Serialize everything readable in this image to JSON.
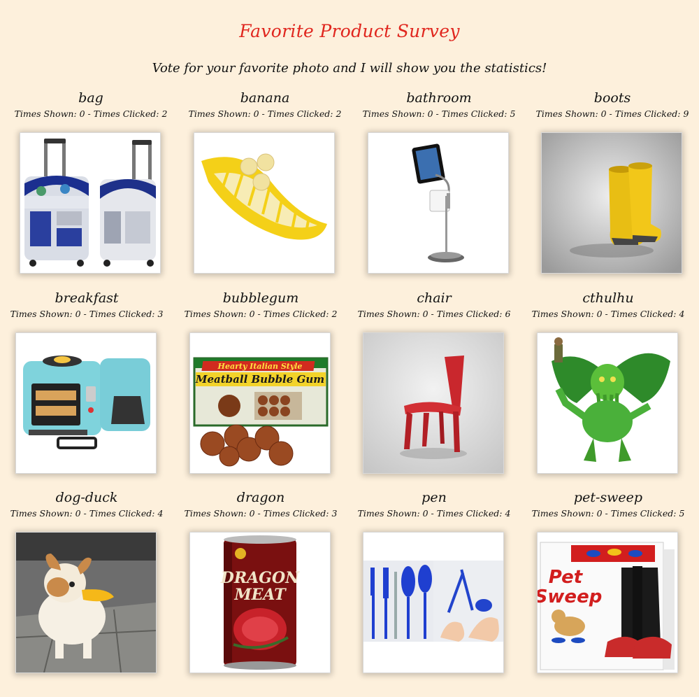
{
  "page": {
    "title": "Favorite Product Survey",
    "subtitle": "Vote for your favorite photo and I will show you the statistics!"
  },
  "colors": {
    "title": "#e0261e",
    "background": "#fdf0dc"
  },
  "products": [
    {
      "name": "bag",
      "stats": "Times Shown: 0 - Times Clicked: 2",
      "icon": "r2d2-suitcase-photo"
    },
    {
      "name": "banana",
      "stats": "Times Shown: 0 - Times Clicked: 2",
      "icon": "banana-slicer-photo"
    },
    {
      "name": "bathroom",
      "stats": "Times Shown: 0 - Times Clicked: 5",
      "icon": "tablet-toilet-paper-stand-photo"
    },
    {
      "name": "boots",
      "stats": "Times Shown: 0 - Times Clicked: 9",
      "icon": "yellow-boots-photo"
    },
    {
      "name": "breakfast",
      "stats": "Times Shown: 0 - Times Clicked: 3",
      "icon": "breakfast-station-photo"
    },
    {
      "name": "bubblegum",
      "stats": "Times Shown: 0 - Times Clicked: 2",
      "icon": "meatball-bubble-gum-photo",
      "photo_text": {
        "line1": "Hearty Italian Style",
        "line2": "Meatball Bubble Gum"
      }
    },
    {
      "name": "chair",
      "stats": "Times Shown: 0 - Times Clicked: 6",
      "icon": "red-chair-photo"
    },
    {
      "name": "cthulhu",
      "stats": "Times Shown: 0 - Times Clicked: 4",
      "icon": "cthulhu-figure-photo"
    },
    {
      "name": "dog-duck",
      "stats": "Times Shown: 0 - Times Clicked: 4",
      "icon": "dog-duck-muzzle-photo"
    },
    {
      "name": "dragon",
      "stats": "Times Shown: 0 - Times Clicked: 3",
      "icon": "dragon-meat-can-photo",
      "photo_text": {
        "line1": "DRAGON",
        "line2": "MEAT"
      }
    },
    {
      "name": "pen",
      "stats": "Times Shown: 0 - Times Clicked: 4",
      "icon": "utensil-pens-photo"
    },
    {
      "name": "pet-sweep",
      "stats": "Times Shown: 0 - Times Clicked: 5",
      "icon": "pet-sweep-box-photo",
      "photo_text": {
        "line1": "Pet",
        "line2": "Sweep"
      }
    }
  ]
}
